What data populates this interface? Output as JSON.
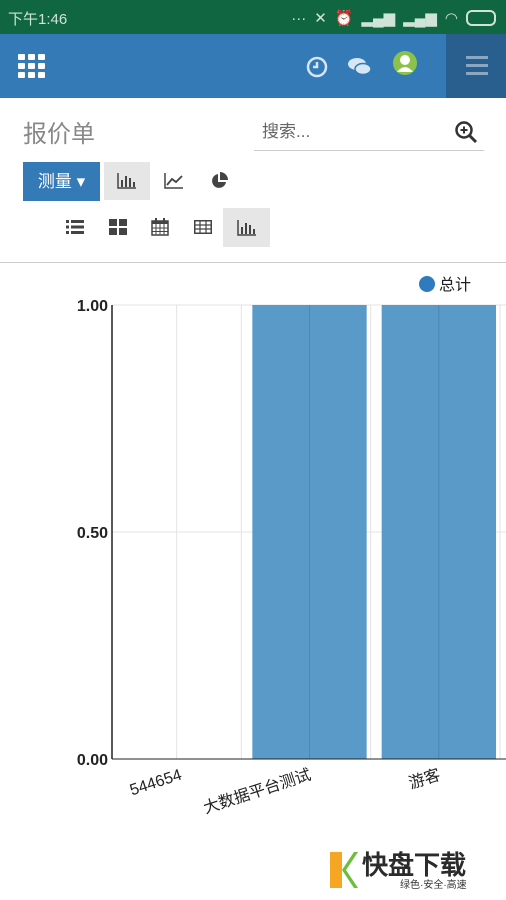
{
  "status_bar": {
    "time": "下午1:46"
  },
  "page": {
    "title": "报价单"
  },
  "search": {
    "placeholder": "搜索..."
  },
  "toolbar": {
    "measure_label": "测量 ▾"
  },
  "chart_data": {
    "type": "bar",
    "categories": [
      "544654",
      "大数据平台测试",
      "游客"
    ],
    "series": [
      {
        "name": "总计",
        "values": [
          0,
          1,
          1
        ],
        "color": "#5a9ac8"
      }
    ],
    "ylim": [
      0,
      1
    ],
    "yticks": [
      "1.00",
      "0.50",
      "0.00"
    ],
    "legend_position": "top-right",
    "grid": true
  },
  "watermark": {
    "brand": "快盘下载",
    "tagline": "绿色·安全·高速"
  }
}
